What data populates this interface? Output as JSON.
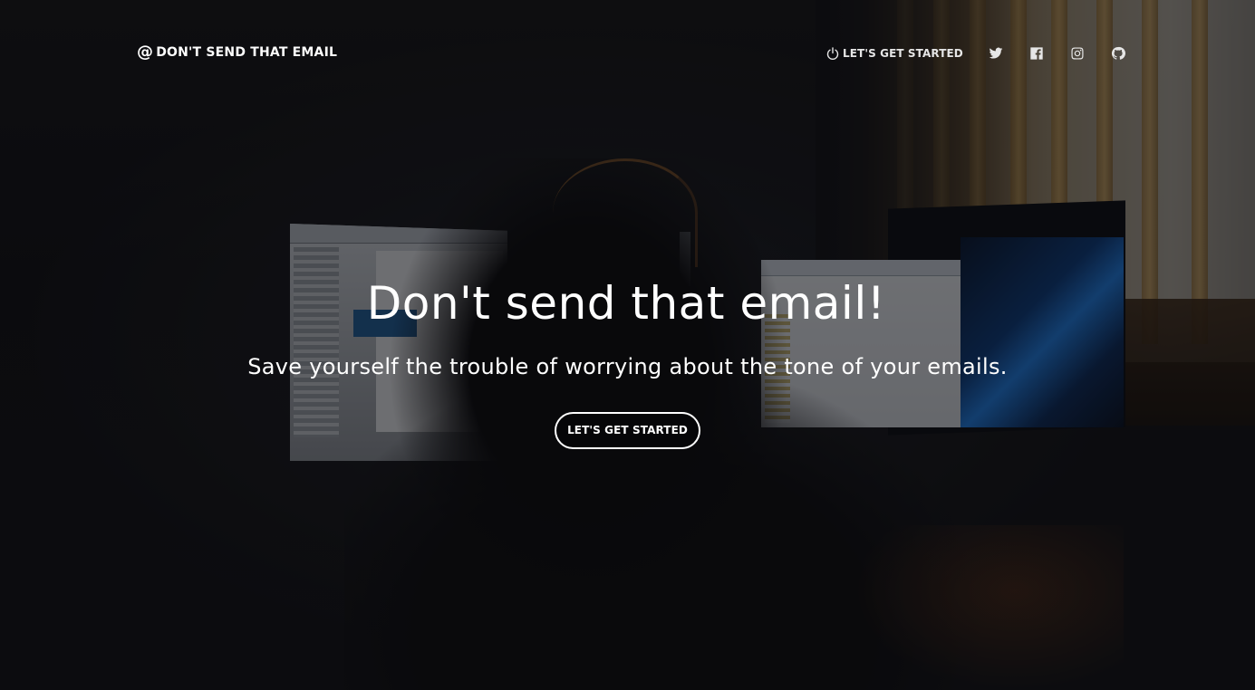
{
  "nav": {
    "brand_icon": "@",
    "brand_label": "DON'T SEND THAT EMAIL",
    "cta_icon": "power-icon",
    "cta_label": "LET'S GET STARTED",
    "social": [
      {
        "name": "twitter-icon"
      },
      {
        "name": "facebook-icon"
      },
      {
        "name": "instagram-icon"
      },
      {
        "name": "github-icon"
      }
    ]
  },
  "hero": {
    "title": "Don't send that email!",
    "subtitle": "Save yourself the trouble of worrying about the tone of your emails.",
    "button_label": "LET'S GET STARTED"
  },
  "colors": {
    "text": "#ffffff",
    "background": "#0d0d0f"
  }
}
